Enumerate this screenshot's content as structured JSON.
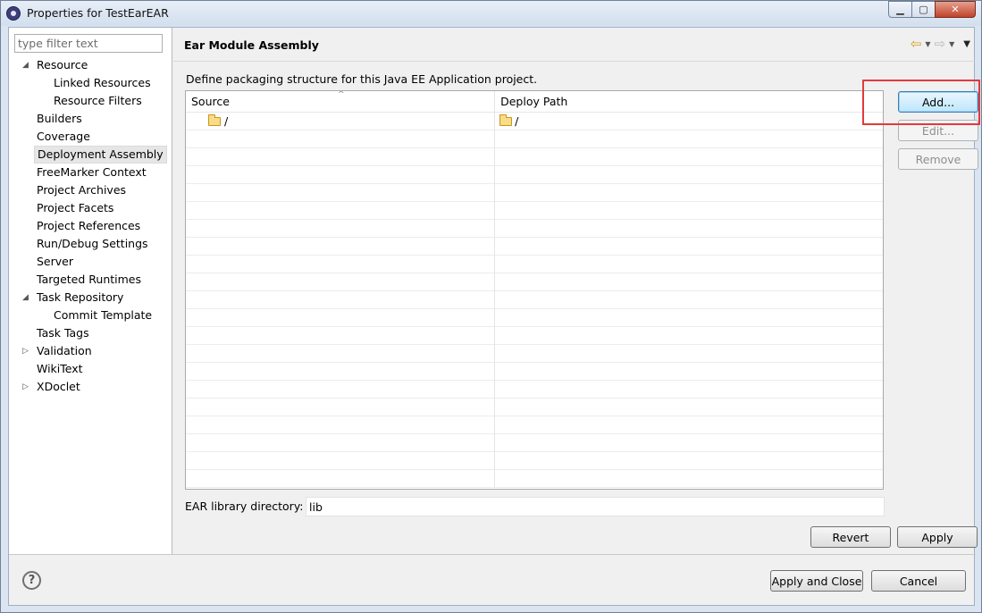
{
  "window": {
    "title": "Properties for TestEarEAR",
    "minimize_glyph": "▁",
    "maximize_glyph": "▢",
    "close_glyph": "✕"
  },
  "filter": {
    "placeholder": "type filter text"
  },
  "tree": [
    {
      "label": "Resource",
      "expander": "◢",
      "level": 0
    },
    {
      "label": "Linked Resources",
      "expander": "",
      "level": 1
    },
    {
      "label": "Resource Filters",
      "expander": "",
      "level": 1
    },
    {
      "label": "Builders",
      "expander": "",
      "level": 0
    },
    {
      "label": "Coverage",
      "expander": "",
      "level": 0
    },
    {
      "label": "Deployment Assembly",
      "expander": "",
      "level": 0,
      "selected": true
    },
    {
      "label": "FreeMarker Context",
      "expander": "",
      "level": 0
    },
    {
      "label": "Project Archives",
      "expander": "",
      "level": 0
    },
    {
      "label": "Project Facets",
      "expander": "",
      "level": 0
    },
    {
      "label": "Project References",
      "expander": "",
      "level": 0
    },
    {
      "label": "Run/Debug Settings",
      "expander": "",
      "level": 0
    },
    {
      "label": "Server",
      "expander": "",
      "level": 0
    },
    {
      "label": "Targeted Runtimes",
      "expander": "",
      "level": 0
    },
    {
      "label": "Task Repository",
      "expander": "◢",
      "level": 0
    },
    {
      "label": "Commit Template",
      "expander": "",
      "level": 1
    },
    {
      "label": "Task Tags",
      "expander": "",
      "level": 0
    },
    {
      "label": "Validation",
      "expander": "▷",
      "level": 0
    },
    {
      "label": "WikiText",
      "expander": "",
      "level": 0
    },
    {
      "label": "XDoclet",
      "expander": "▷",
      "level": 0
    }
  ],
  "page": {
    "title": "Ear Module Assembly",
    "description": "Define packaging structure for this Java EE Application project.",
    "nav": {
      "back_glyph": "⇦",
      "forward_glyph": "⇨",
      "dropdown_glyph": "▼",
      "menu_glyph": "▼"
    }
  },
  "table": {
    "columns": {
      "source": "Source",
      "deploy": "Deploy Path",
      "sort_glyph": "^"
    },
    "rows": [
      {
        "source": "/",
        "deploy": "/"
      }
    ],
    "empty_rows": 20
  },
  "buttons": {
    "add": "Add...",
    "edit": "Edit...",
    "remove": "Remove",
    "revert": "Revert",
    "apply": "Apply",
    "apply_close": "Apply and Close",
    "cancel": "Cancel"
  },
  "ear_library": {
    "label": "EAR library directory:",
    "value": "lib"
  },
  "help": {
    "glyph": "?"
  }
}
